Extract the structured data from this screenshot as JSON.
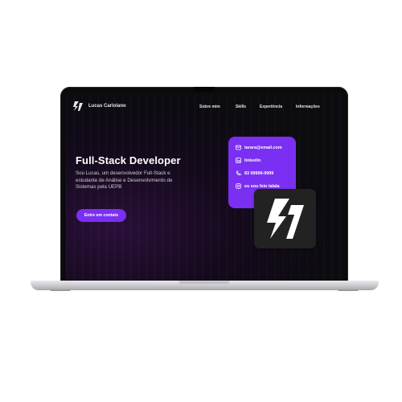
{
  "site": {
    "brand_name": "Lucas Carlolano",
    "brand_icon": "lightning-monogram-icon"
  },
  "nav": {
    "items": [
      {
        "label": "Sobre mim"
      },
      {
        "label": "Skills"
      },
      {
        "label": "Experiência"
      },
      {
        "label": "Informações"
      }
    ]
  },
  "hero": {
    "title": "Full-Stack Developer",
    "description": "Sou Lucas, um desenvolvedor Full-Stack e estudante de Análise e Desenvolvimento de Sistemas pela UEPB",
    "cta_label": "Entre em contato"
  },
  "contact": {
    "email": "tarara@email.com",
    "linkedin": "linkedin",
    "phone": "83 99999-9999",
    "instagram": "eu sou feio lalala"
  },
  "colors": {
    "accent": "#7b2ff2",
    "background": "#0c0b10",
    "text": "#ffffff",
    "logo_box": "#222222"
  }
}
